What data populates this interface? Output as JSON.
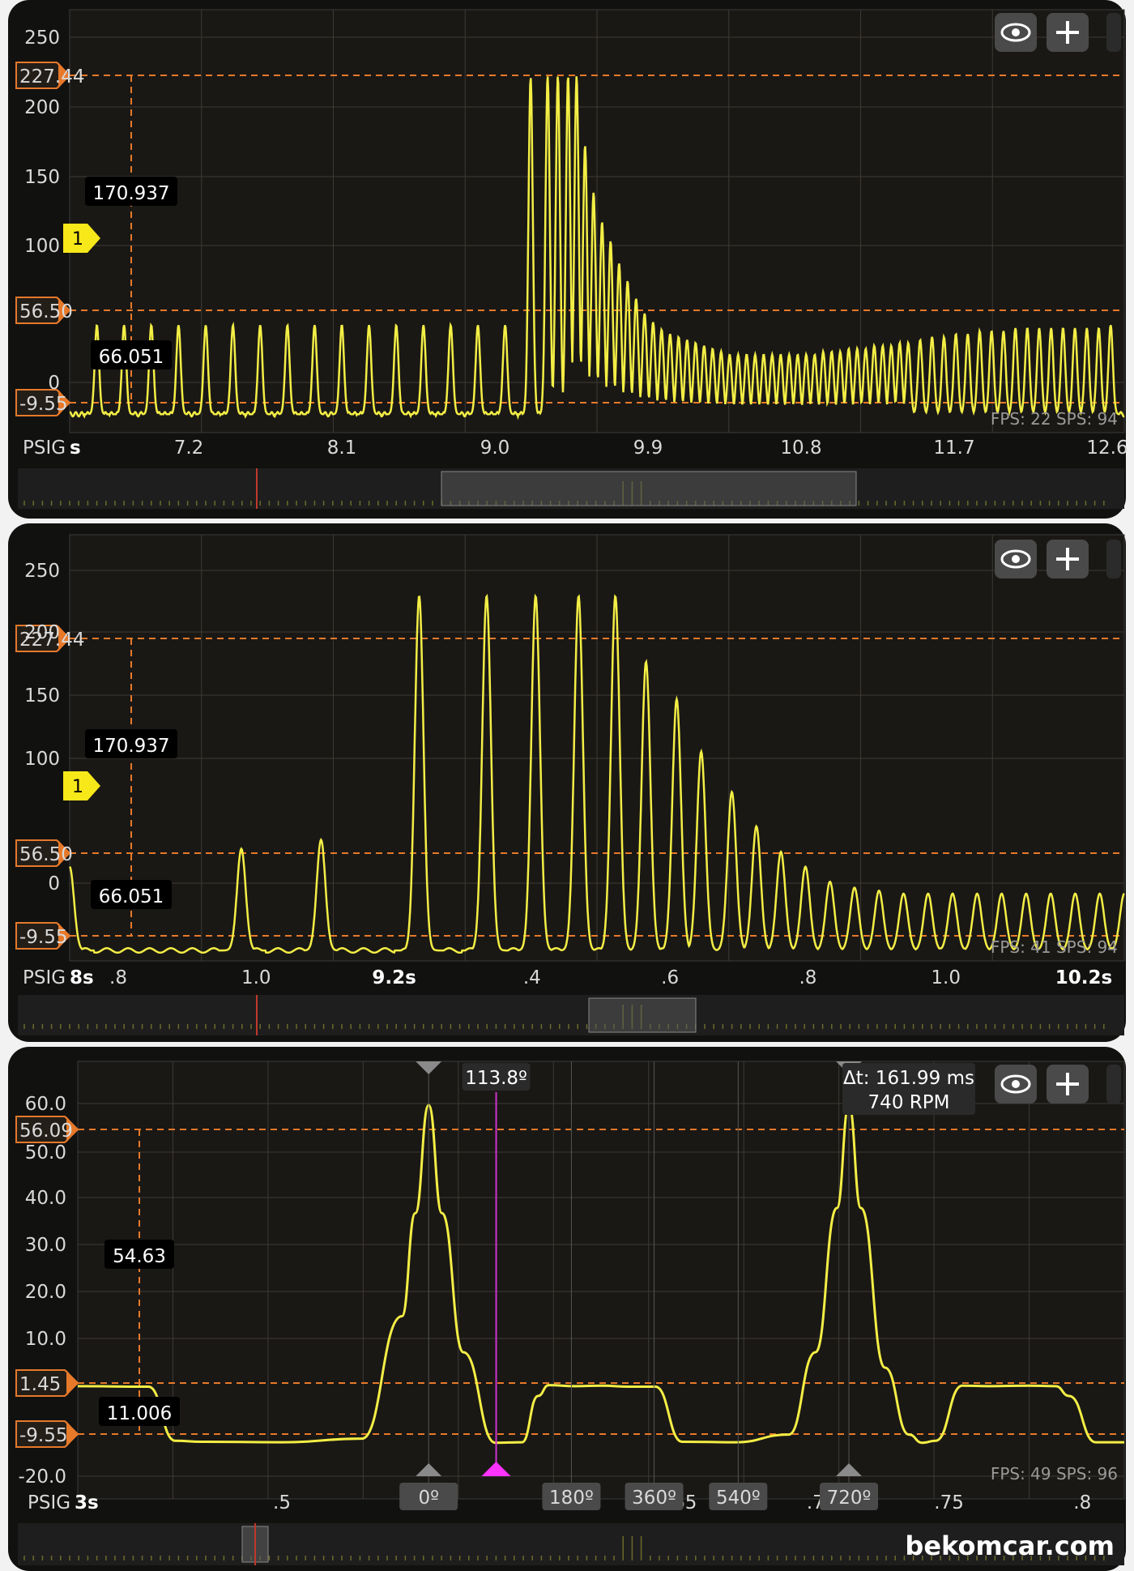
{
  "site": "bekomcar.com",
  "colors": {
    "trace": "#f3ee45",
    "cursor": "#e6792a",
    "marker": "#f7e819",
    "phase_line": "#cc33cc"
  },
  "icons": [
    "eye-icon",
    "plus-icon"
  ],
  "chart_data": [
    {
      "type": "line",
      "title": "",
      "unit_label": "PSIG",
      "time_unit_label": "s",
      "y_ticks": [
        "250",
        "200",
        "150",
        "100",
        "0"
      ],
      "x_ticks": [
        "7.2",
        "8.1",
        "9.0",
        "9.9",
        "10.8",
        "11.7",
        "12.6"
      ],
      "xlim": [
        6.5,
        12.7
      ],
      "ylim": [
        -15,
        272
      ],
      "grid": true,
      "cursors": {
        "upper": "227.44",
        "lower": "-9.55",
        "mid": "56.50",
        "readout_top": "170.937",
        "readout_bottom": "66.051",
        "upper_value": 227.44,
        "lower_value": -9.55,
        "mid_value": 56.5
      },
      "trigger_marker": {
        "label": "1",
        "value": 103
      },
      "status": "FPS: 22  SPS: 94",
      "series": [
        {
          "baseline": -2.5,
          "x": [
            6.66,
            6.82,
            6.98,
            7.14,
            7.3,
            7.46,
            7.62,
            7.78,
            7.94,
            8.1,
            8.26,
            8.42,
            8.58,
            8.74,
            8.9,
            9.06,
            9.21,
            9.31,
            9.37,
            9.43,
            9.48,
            9.53,
            9.58,
            9.63,
            9.68,
            9.73,
            9.78,
            9.83,
            9.88,
            9.93,
            9.98,
            10.03,
            10.08,
            10.13,
            10.18,
            10.23,
            10.28,
            10.33,
            10.38,
            10.43,
            10.48,
            10.53,
            10.58,
            10.63,
            10.68,
            10.73,
            10.78,
            10.83,
            10.88,
            10.93,
            10.98,
            11.03,
            11.08,
            11.13,
            11.18,
            11.23,
            11.28,
            11.33,
            11.38,
            11.43,
            11.5,
            11.57,
            11.64,
            11.71,
            11.78,
            11.85,
            11.92,
            11.99,
            12.06,
            12.13,
            12.2,
            12.27,
            12.34,
            12.41,
            12.48,
            12.55,
            12.62
          ],
          "y": [
            58,
            58,
            58,
            58,
            58,
            58,
            58,
            58,
            58,
            58,
            58,
            58,
            58,
            58,
            58,
            58,
            226,
            227,
            227,
            227,
            227,
            180,
            148,
            128,
            115,
            100,
            88,
            76,
            66,
            60,
            55,
            52,
            50,
            48,
            46,
            44,
            42,
            40,
            38,
            38,
            38,
            38,
            38,
            38,
            38,
            38,
            38,
            38,
            38,
            40,
            40,
            40,
            42,
            42,
            42,
            44,
            44,
            44,
            46,
            46,
            48,
            50,
            50,
            52,
            52,
            54,
            54,
            54,
            56,
            56,
            56,
            56,
            56,
            56,
            56,
            56,
            58
          ]
        }
      ]
    },
    {
      "type": "line",
      "title": "",
      "unit_label": "PSIG",
      "time_unit_label": "8s",
      "y_ticks": [
        "250",
        "200",
        "150",
        "100",
        "0"
      ],
      "x_ticks": [
        ".8",
        "1.0",
        "9.2s",
        ".4",
        ".6",
        ".8",
        "1.0",
        "10.2s"
      ],
      "x_tick_major": [
        false,
        false,
        true,
        false,
        false,
        false,
        false,
        true
      ],
      "xlim": [
        8.64,
        10.36
      ],
      "ylim": [
        -15,
        270
      ],
      "grid": true,
      "cursors": {
        "upper": "227.44",
        "lower": "-9.55",
        "mid": "56.50",
        "readout_top": "170.937",
        "readout_bottom": "66.051",
        "upper_value": 227.44,
        "lower_value": -9.55,
        "mid_value": 56.5
      },
      "trigger_marker": {
        "label": "1",
        "value": 100
      },
      "status": "FPS: 41  SPS: 94",
      "series": [
        {
          "baseline": -8,
          "x": [
            8.64,
            8.92,
            9.05,
            9.21,
            9.32,
            9.4,
            9.47,
            9.53,
            9.58,
            9.63,
            9.67,
            9.72,
            9.76,
            9.8,
            9.84,
            9.88,
            9.92,
            9.96,
            10.0,
            10.04,
            10.08,
            10.12,
            10.16,
            10.2,
            10.24,
            10.28,
            10.32,
            10.36
          ],
          "y": [
            48,
            60,
            66,
            229,
            229,
            229,
            229,
            229,
            185,
            160,
            125,
            98,
            75,
            58,
            48,
            38,
            34,
            32,
            30,
            30,
            30,
            30,
            30,
            30,
            30,
            30,
            30,
            30
          ]
        }
      ]
    },
    {
      "type": "line",
      "title": "",
      "unit_label": "PSIG",
      "time_unit_label": "3s",
      "y_ticks": [
        "60.0",
        "50.0",
        "40.0",
        "30.0",
        "20.0",
        "10.0",
        "-20.0"
      ],
      "x_ticks": [
        ".5",
        ".65",
        ".7",
        ".75",
        ".8"
      ],
      "x_tick_values": [
        0.5,
        0.65,
        0.7,
        0.75,
        0.8
      ],
      "xlim": [
        0.4235,
        0.8157
      ],
      "ylim": [
        -20.5,
        64.5
      ],
      "grid": true,
      "cursors": {
        "upper": "56.09",
        "lower": "-9.55",
        "mid": "1.45",
        "readout_top": "54.63",
        "readout_bottom": "11.006",
        "upper_value": 56.09,
        "lower_value": -9.55,
        "mid_value": 1.45
      },
      "phase_markers": [
        "0º",
        "180º",
        "360º",
        "540º",
        "720º"
      ],
      "phase_x": [
        0.555,
        0.6085,
        0.6395,
        0.671,
        0.7125
      ],
      "phase_cursor_label": "113.8º",
      "phase_cursor_x": 0.5803,
      "delta_readout": [
        "Δt: 161.99 ms",
        "740 RPM"
      ],
      "status": "FPS: 49  SPS: 96",
      "series": [
        {
          "x": [
            0.4235,
            0.45,
            0.46,
            0.47,
            0.5,
            0.53,
            0.545,
            0.55,
            0.555,
            0.56,
            0.568,
            0.58,
            0.59,
            0.596,
            0.6,
            0.61,
            0.62,
            0.63,
            0.64,
            0.65,
            0.67,
            0.69,
            0.7,
            0.708,
            0.7125,
            0.717,
            0.726,
            0.735,
            0.74,
            0.745,
            0.755,
            0.765,
            0.78,
            0.79,
            0.795,
            0.805,
            0.8157
          ],
          "y": [
            1.4,
            1.3,
            -9.2,
            -9.4,
            -9.5,
            -8.8,
            15,
            35,
            56,
            35,
            8,
            -9.6,
            -9.5,
            -0.5,
            1.6,
            1.4,
            1.5,
            1.3,
            1.3,
            -9.4,
            -9.5,
            -8,
            8,
            36,
            56,
            36,
            5,
            -8,
            -9.6,
            -9.2,
            1.5,
            1.4,
            1.5,
            1.4,
            -0.5,
            -9.5,
            -9.5
          ]
        }
      ]
    }
  ]
}
